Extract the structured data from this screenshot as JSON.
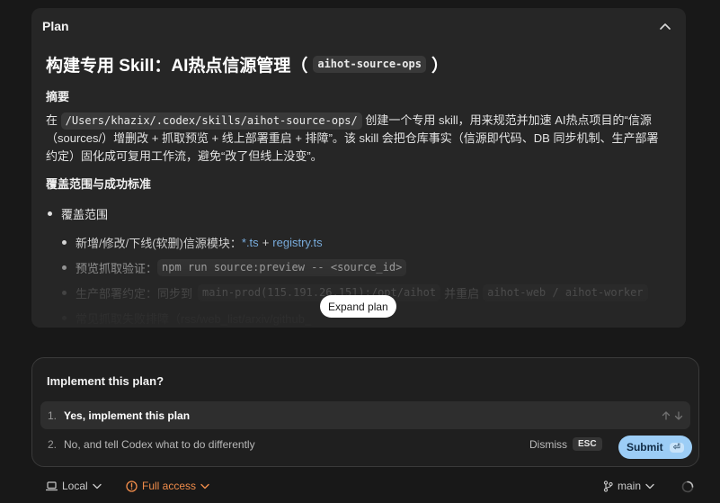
{
  "plan": {
    "header_label": "Plan",
    "title_prefix": "构建专用 Skill：AI热点信源管理（",
    "title_code": "aihot-source-ops",
    "title_suffix": "）",
    "summary_heading": "摘要",
    "summary_pre": "在",
    "summary_code": "/Users/khazix/.codex/skills/aihot-source-ops/",
    "summary_text1": "创建一个专用 skill，用来规范并加速 AI热点项目的“信源",
    "summary_text2": "（sources/）增删改 + 抓取预览 + 线上部署重启 + 排障”。该 skill 会把仓库事实（信源即代码、DB 同步机制、生产部署",
    "summary_text3": "约定）固化成可复用工作流，避免“改了但线上没变”。",
    "scope_heading": "覆盖范围与成功标准",
    "bullet_scope": "覆盖范围",
    "sub1_text": "新增/修改/下线(软删)信源模块：",
    "sub1_link1": "*.ts",
    "sub1_plus": "+",
    "sub1_link2": "registry.ts",
    "sub2_text": "预览抓取验证：",
    "sub2_code": "npm run source:preview -- <source_id>",
    "sub3_text1": "生产部署约定：同步到",
    "sub3_code1": "main-prod(115.191.26.151):/opt/aihot",
    "sub3_text2": "并重启",
    "sub3_code2": "aihot-web / aihot-worker",
    "sub4_text": "常见抓取失败排障（rss/web_list/arxiv/github_",
    "expand_label": "Expand plan"
  },
  "implement": {
    "question": "Implement this plan?",
    "option1_num": "1.",
    "option1_text": "Yes, implement this plan",
    "option2_num": "2.",
    "option2_text": "No, and tell Codex what to do differently",
    "dismiss_label": "Dismiss",
    "esc_key": "ESC",
    "submit_label": "Submit",
    "enter_key": "⏎"
  },
  "bottom": {
    "env_label": "Local",
    "access_label": "Full access",
    "branch_label": "main"
  },
  "colors": {
    "background": "#181818",
    "card": "#262626",
    "link": "#7fb6ea",
    "submit": "#9ccdf6",
    "warning": "#f08c4a"
  },
  "icons": [
    "chevron-up-icon",
    "arrow-up-icon",
    "arrow-down-icon",
    "laptop-icon",
    "chevron-down-icon",
    "warning-circle-icon",
    "git-branch-icon",
    "spinner-icon",
    "enter-key-icon"
  ]
}
